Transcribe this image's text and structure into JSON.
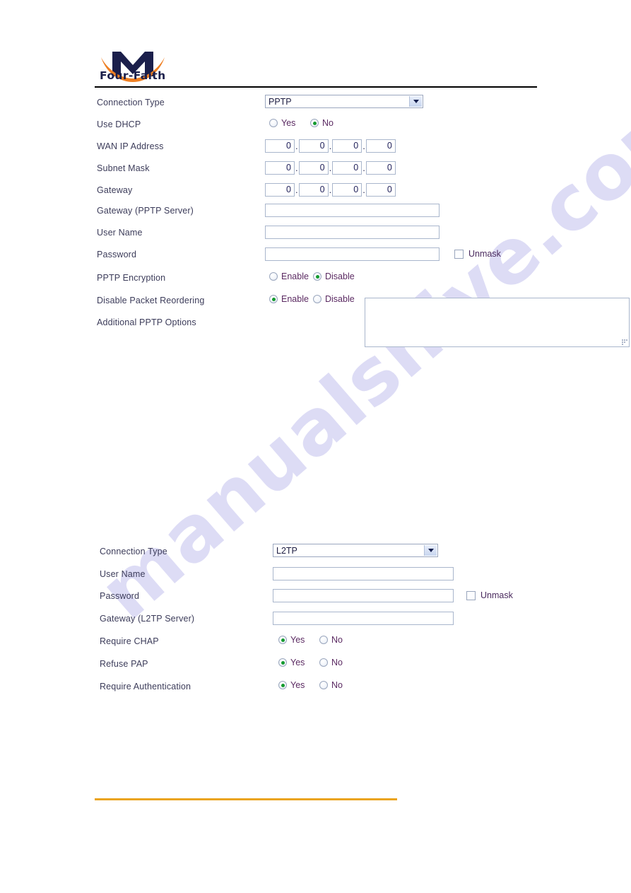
{
  "brand": {
    "name": "Four-Faith",
    "logo_icon": "four-faith-m-logo-icon",
    "logo_navy": "#1b1f4b",
    "logo_orange": "#ee7f23"
  },
  "watermark": {
    "text": "manualshive.com",
    "color": "#c9c8ef"
  },
  "theme": {
    "header_rule_color": "#000000",
    "footer_rule_color": "#eaa41e",
    "label_color": "#3c3c5a",
    "radio_label_color": "#5b2a62",
    "radio_selected_dot": "#139a2e",
    "input_border": "#a9b6cc",
    "select_border": "#9ba7bf"
  },
  "sections": [
    {
      "id": "pptp",
      "rows": [
        {
          "name": "connection-type",
          "label": "Connection Type",
          "control": "select",
          "value": "PPTP",
          "options": [
            "PPTP",
            "L2TP"
          ]
        },
        {
          "name": "use-dhcp",
          "label": "Use DHCP",
          "control": "radio",
          "options": [
            {
              "label": "Yes",
              "checked": false
            },
            {
              "label": "No",
              "checked": true
            }
          ]
        },
        {
          "name": "wan-ip-address",
          "label": "WAN IP Address",
          "control": "octets",
          "octets": [
            "0",
            "0",
            "0",
            "0"
          ]
        },
        {
          "name": "subnet-mask",
          "label": "Subnet Mask",
          "control": "octets",
          "octets": [
            "0",
            "0",
            "0",
            "0"
          ]
        },
        {
          "name": "gateway",
          "label": "Gateway",
          "control": "octets",
          "octets": [
            "0",
            "0",
            "0",
            "0"
          ]
        },
        {
          "name": "gateway-pptp-server",
          "label": "Gateway (PPTP Server)",
          "control": "text",
          "value": ""
        },
        {
          "name": "user-name",
          "label": "User Name",
          "control": "text",
          "value": ""
        },
        {
          "name": "password",
          "label": "Password",
          "control": "text",
          "value": "",
          "checkbox": {
            "label": "Unmask",
            "checked": false
          }
        },
        {
          "name": "pptp-encryption",
          "label": "PPTP Encryption",
          "control": "radio",
          "options": [
            {
              "label": "Enable",
              "checked": false
            },
            {
              "label": "Disable",
              "checked": true
            }
          ]
        },
        {
          "name": "disable-packet-reordering",
          "label": "Disable Packet Reordering",
          "control": "radio",
          "options": [
            {
              "label": "Enable",
              "checked": true
            },
            {
              "label": "Disable",
              "checked": false
            }
          ]
        },
        {
          "name": "additional-pptp-options",
          "label": "Additional PPTP Options",
          "control": "textarea",
          "value": ""
        }
      ]
    },
    {
      "id": "l2tp",
      "rows": [
        {
          "name": "connection-type",
          "label": "Connection Type",
          "control": "select",
          "value": "L2TP",
          "options": [
            "PPTP",
            "L2TP"
          ]
        },
        {
          "name": "user-name",
          "label": "User Name",
          "control": "text",
          "value": ""
        },
        {
          "name": "password",
          "label": "Password",
          "control": "text",
          "value": "",
          "checkbox": {
            "label": "Unmask",
            "checked": false
          }
        },
        {
          "name": "gateway-l2tp-server",
          "label": "Gateway (L2TP Server)",
          "control": "text",
          "value": ""
        },
        {
          "name": "require-chap",
          "label": "Require CHAP",
          "control": "radio",
          "options": [
            {
              "label": "Yes",
              "checked": true
            },
            {
              "label": "No",
              "checked": false
            }
          ]
        },
        {
          "name": "refuse-pap",
          "label": "Refuse PAP",
          "control": "radio",
          "options": [
            {
              "label": "Yes",
              "checked": true
            },
            {
              "label": "No",
              "checked": false
            }
          ]
        },
        {
          "name": "require-authentication",
          "label": "Require Authentication",
          "control": "radio",
          "options": [
            {
              "label": "Yes",
              "checked": true
            },
            {
              "label": "No",
              "checked": false
            }
          ]
        }
      ]
    }
  ]
}
